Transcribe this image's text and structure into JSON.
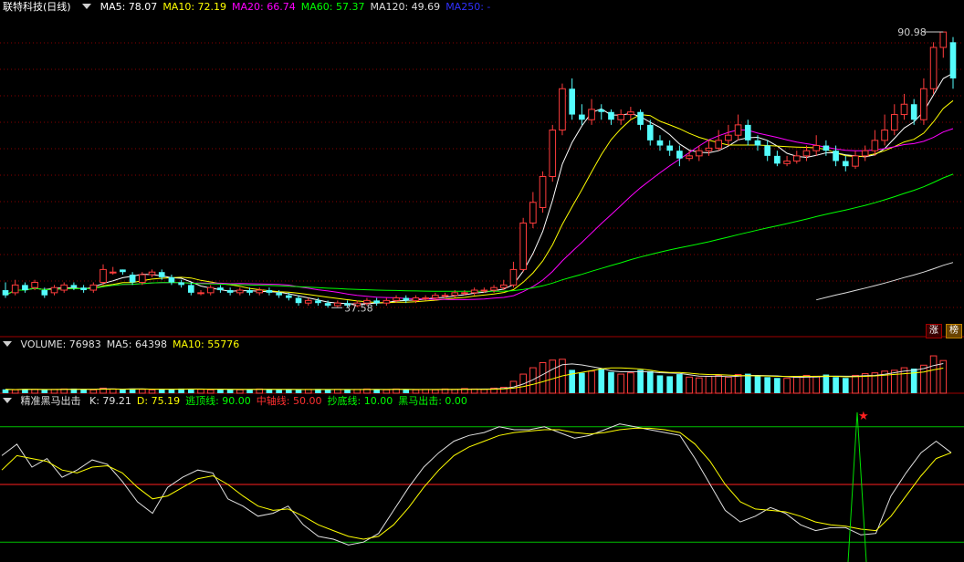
{
  "main": {
    "title": "联特科技(日线)",
    "ma": [
      {
        "label": "MA5: 78.07",
        "color": "#ffffff"
      },
      {
        "label": "MA10: 72.19",
        "color": "#ffff00"
      },
      {
        "label": "MA20: 66.74",
        "color": "#ff00ff"
      },
      {
        "label": "MA60: 57.37",
        "color": "#00ff00"
      },
      {
        "label": "MA120: 49.69",
        "color": "#dddddd"
      },
      {
        "label": "MA250: -",
        "color": "#3030ff"
      }
    ],
    "high_label": "90.98",
    "low_label": "37.58",
    "badges": [
      "涨",
      "榜"
    ]
  },
  "volume": {
    "items": [
      {
        "label": "VOLUME: 76983",
        "color": "#e0e0e0"
      },
      {
        "label": "MA5: 64398",
        "color": "#e0e0e0"
      },
      {
        "label": "MA10: 55776",
        "color": "#ffff00"
      }
    ]
  },
  "indicator": {
    "name": "精准黑马出击",
    "items": [
      {
        "label": "K: 79.21",
        "color": "#e0e0e0"
      },
      {
        "label": "D: 75.19",
        "color": "#ffff00"
      },
      {
        "label": "逃顶线: 90.00",
        "color": "#00ff00"
      },
      {
        "label": "中轴线: 50.00",
        "color": "#ff3030"
      },
      {
        "label": "抄底线: 10.00",
        "color": "#00ff00"
      },
      {
        "label": "黑马出击: 0.00",
        "color": "#00ff00"
      }
    ]
  },
  "colors": {
    "up": "#ff3c3c",
    "down": "#54fcfc",
    "grid": "#8a0000"
  },
  "chart_data": [
    {
      "type": "candlestick",
      "title": "联特科技(日线)",
      "ylim": [
        35,
        94
      ],
      "series": [
        {
          "name": "price",
          "ohlc": [
            [
              41,
              40,
              42.5,
              39.5
            ],
            [
              40.5,
              42,
              43,
              40
            ],
            [
              42,
              41,
              42.5,
              40.5
            ],
            [
              41.5,
              42.5,
              43,
              41
            ],
            [
              41,
              40,
              41.5,
              39.5
            ],
            [
              40.5,
              41.5,
              42,
              40
            ],
            [
              41,
              42,
              42.5,
              40.5
            ],
            [
              42,
              41.5,
              42.5,
              41
            ],
            [
              41.5,
              41,
              42,
              40.5
            ],
            [
              41,
              42,
              42.5,
              40.5
            ],
            [
              42.5,
              45,
              46,
              42
            ],
            [
              44.5,
              44.5,
              45.5,
              44
            ],
            [
              45,
              44.5,
              45,
              44
            ],
            [
              44,
              42.5,
              44.5,
              42
            ],
            [
              42.5,
              44,
              44.5,
              42
            ],
            [
              44,
              44.5,
              45,
              43.5
            ],
            [
              44.5,
              43.5,
              45,
              43
            ],
            [
              43.5,
              42.5,
              44,
              42
            ],
            [
              42.5,
              42,
              43,
              41.5
            ],
            [
              42,
              40.5,
              42.5,
              40
            ],
            [
              40.5,
              40.5,
              41,
              40
            ],
            [
              40.5,
              41.5,
              42,
              40
            ],
            [
              41.5,
              41,
              42,
              40.5
            ],
            [
              41,
              40.5,
              41.5,
              40
            ],
            [
              40.5,
              41,
              41.5,
              40
            ],
            [
              41,
              40.5,
              41.5,
              40
            ],
            [
              40.5,
              41,
              41.5,
              40
            ],
            [
              41,
              40.5,
              41.5,
              40
            ],
            [
              40.5,
              40,
              41,
              39.5
            ],
            [
              40,
              39.5,
              40.5,
              39
            ],
            [
              39.5,
              38.5,
              40,
              38
            ],
            [
              38.5,
              39,
              39.5,
              38
            ],
            [
              39,
              38.5,
              39.5,
              38
            ],
            [
              38.5,
              38,
              39,
              37.6
            ],
            [
              38,
              38.5,
              39,
              37.6
            ],
            [
              38.5,
              38,
              39,
              37.7
            ],
            [
              38,
              38.5,
              39,
              37.7
            ],
            [
              38.5,
              39,
              39.5,
              38
            ],
            [
              39,
              38.5,
              39.5,
              38
            ],
            [
              38.5,
              39,
              39.5,
              38
            ],
            [
              39,
              39.5,
              40,
              38.5
            ],
            [
              39.5,
              39,
              40,
              38.5
            ],
            [
              39,
              39.5,
              40,
              38.5
            ],
            [
              39.5,
              39.5,
              40,
              39
            ],
            [
              39.5,
              40,
              40.5,
              39
            ],
            [
              40,
              40,
              40.5,
              39.5
            ],
            [
              40,
              40.5,
              41,
              39.5
            ],
            [
              40.5,
              40.5,
              41,
              40
            ],
            [
              40.5,
              41,
              41.5,
              40
            ],
            [
              41,
              41,
              41.5,
              40.5
            ],
            [
              41,
              41.5,
              42,
              40.5
            ],
            [
              41.5,
              42,
              43,
              41
            ],
            [
              42,
              45,
              46.5,
              41.5
            ],
            [
              45,
              54,
              55,
              44.5
            ],
            [
              54,
              58,
              60,
              53
            ],
            [
              57,
              63,
              64,
              56
            ],
            [
              63,
              72,
              73,
              62
            ],
            [
              72,
              80,
              81,
              71
            ],
            [
              80,
              75,
              82,
              74
            ],
            [
              75,
              74,
              77,
              73
            ],
            [
              74,
              76,
              78,
              73
            ],
            [
              76,
              75.5,
              77,
              74
            ],
            [
              75.5,
              74,
              76,
              73
            ],
            [
              74,
              75,
              76,
              73
            ],
            [
              75,
              75.5,
              76.5,
              74
            ],
            [
              75.5,
              73,
              76,
              72
            ],
            [
              73,
              70,
              74,
              69
            ],
            [
              70,
              69,
              71,
              68
            ],
            [
              69,
              68,
              70,
              67
            ],
            [
              68,
              66.5,
              69,
              65
            ],
            [
              66.5,
              67,
              68,
              66
            ],
            [
              67,
              68,
              69,
              66
            ],
            [
              68,
              68.5,
              70,
              67
            ],
            [
              68.5,
              70,
              72,
              68
            ],
            [
              70,
              71,
              73,
              69
            ],
            [
              71,
              73,
              75,
              70
            ],
            [
              73,
              70,
              74,
              69
            ],
            [
              70,
              69,
              71,
              68
            ],
            [
              69,
              67,
              70,
              66
            ],
            [
              67,
              65.5,
              68,
              65
            ],
            [
              65.5,
              66,
              67,
              65
            ],
            [
              66,
              67,
              68,
              65.5
            ],
            [
              67,
              68,
              69,
              66
            ],
            [
              68,
              69,
              71,
              67
            ],
            [
              69,
              68,
              70,
              67
            ],
            [
              68,
              66,
              69,
              65
            ],
            [
              66,
              65,
              67,
              64
            ],
            [
              65,
              67,
              68,
              64.5
            ],
            [
              67,
              68,
              69,
              66
            ],
            [
              68,
              70,
              72,
              67
            ],
            [
              70,
              72,
              75,
              69
            ],
            [
              72,
              75,
              77,
              71
            ],
            [
              75,
              77,
              79,
              74
            ],
            [
              77,
              74,
              78,
              73
            ],
            [
              74,
              80,
              82,
              73
            ],
            [
              80,
              88,
              89,
              79
            ],
            [
              88,
              90.98,
              91,
              86
            ],
            [
              89,
              82,
              90,
              80
            ]
          ]
        },
        {
          "name": "MA5"
        },
        {
          "name": "MA10"
        },
        {
          "name": "MA20"
        },
        {
          "name": "MA60"
        },
        {
          "name": "MA120"
        }
      ]
    },
    {
      "type": "bar",
      "title": "VOLUME",
      "values": [
        9,
        8,
        10,
        9,
        8,
        9,
        10,
        11,
        9,
        8,
        12,
        10,
        9,
        11,
        9,
        8,
        10,
        9,
        11,
        10,
        9,
        8,
        10,
        9,
        8,
        9,
        10,
        9,
        8,
        9,
        8,
        9,
        10,
        8,
        9,
        8,
        9,
        10,
        9,
        8,
        10,
        9,
        8,
        9,
        8,
        10,
        9,
        11,
        10,
        9,
        12,
        14,
        28,
        45,
        60,
        72,
        78,
        80,
        55,
        48,
        52,
        58,
        50,
        45,
        48,
        55,
        52,
        42,
        40,
        45,
        38,
        36,
        40,
        42,
        38,
        44,
        46,
        40,
        38,
        36,
        35,
        38,
        42,
        40,
        44,
        38,
        36,
        42,
        46,
        48,
        52,
        54,
        60,
        58,
        66,
        88,
        76983
      ]
    },
    {
      "type": "line",
      "title": "精准黑马出击",
      "ylim": [
        0,
        100
      ],
      "series": [
        {
          "name": "K",
          "values": [
            70,
            78,
            62,
            68,
            55,
            60,
            67,
            64,
            52,
            38,
            30,
            48,
            55,
            60,
            58,
            40,
            35,
            28,
            30,
            35,
            22,
            14,
            12,
            8,
            10,
            16,
            32,
            48,
            62,
            72,
            80,
            84,
            86,
            90,
            88,
            88,
            90,
            86,
            82,
            84,
            88,
            92,
            90,
            88,
            86,
            84,
            68,
            50,
            32,
            24,
            28,
            34,
            30,
            22,
            18,
            20,
            20,
            15,
            16,
            42,
            58,
            72,
            80,
            72
          ]
        },
        {
          "name": "D",
          "values": [
            60,
            70,
            68,
            66,
            60,
            58,
            62,
            63,
            58,
            48,
            40,
            42,
            48,
            54,
            56,
            50,
            42,
            35,
            32,
            33,
            28,
            22,
            18,
            14,
            12,
            14,
            22,
            34,
            48,
            60,
            70,
            76,
            80,
            84,
            86,
            87,
            88,
            88,
            86,
            85,
            86,
            88,
            89,
            89,
            88,
            86,
            78,
            66,
            50,
            38,
            33,
            32,
            31,
            28,
            24,
            22,
            21,
            19,
            18,
            28,
            42,
            56,
            68,
            72
          ]
        },
        {
          "name": "黑马出击",
          "values": [
            100
          ]
        }
      ],
      "reference_lines": [
        90,
        50,
        10
      ]
    }
  ]
}
